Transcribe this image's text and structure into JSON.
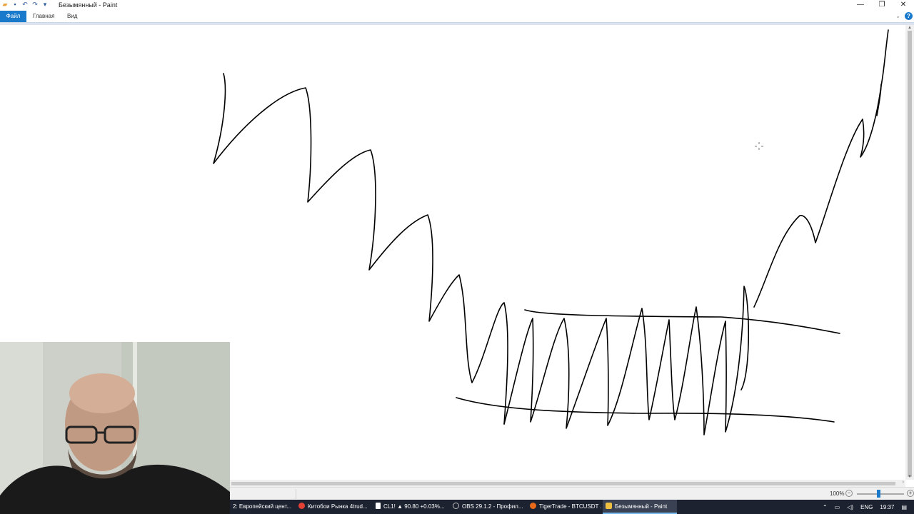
{
  "window": {
    "title": "Безымянный - Paint",
    "controls": {
      "minimize": "—",
      "restore": "❐",
      "close": "✕"
    }
  },
  "qat": {
    "save": "▪",
    "undo": "↶",
    "redo": "↷",
    "dropdown": "▾"
  },
  "ribbon": {
    "tabs": [
      "Файл",
      "Главная",
      "Вид"
    ],
    "collapse": "⌄",
    "help": "?"
  },
  "statusbar": {
    "zoom_label": "100%",
    "zoom_minus": "−",
    "zoom_plus": "+"
  },
  "taskbar": {
    "items": [
      {
        "label": "2: Европейский цент...",
        "icon_color": "#1c2230"
      },
      {
        "label": "Китобои Рынка 4trud...",
        "icon_color": "#e34133"
      },
      {
        "label": "CL1! ▲ 90.80 +0.03%...",
        "icon_color": "#ffffff"
      },
      {
        "label": "OBS 29.1.2 - Профил...",
        "icon_color": "#bbbbbb"
      },
      {
        "label": "TigerTrade - BTCUSDT ...",
        "icon_color": "#e86a1a"
      },
      {
        "label": "Безымянный - Paint",
        "icon_color": "#f0c040"
      }
    ],
    "tray": {
      "lang": "ENG",
      "time": "19:37"
    }
  },
  "icons": {
    "qat_save": "floppy-icon",
    "crosshair": "crosshair-icon",
    "help": "help-icon",
    "notifications": "notification-icon"
  },
  "colors": {
    "accent": "#1979ca",
    "taskbar": "#1c2230"
  }
}
